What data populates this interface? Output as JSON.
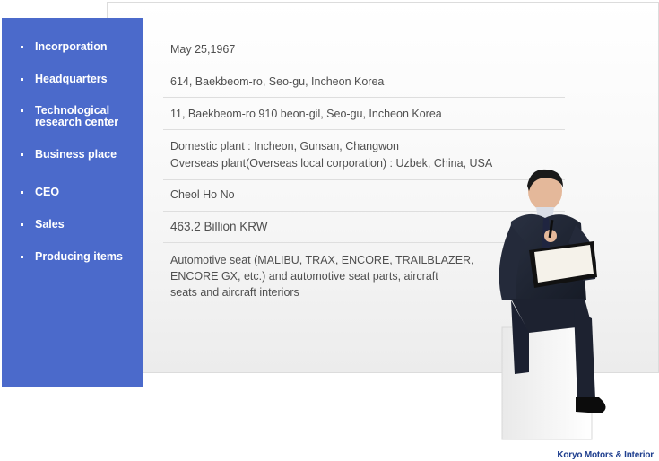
{
  "sidebar": {
    "items": [
      {
        "label": "Incorporation"
      },
      {
        "label": "Headquarters"
      },
      {
        "label": "Technological research center"
      },
      {
        "label": "Business place"
      },
      {
        "label": "CEO"
      },
      {
        "label": "Sales"
      },
      {
        "label": "Producing items"
      }
    ]
  },
  "details": {
    "incorporation": "May 25,1967",
    "headquarters": "614, Baekbeom-ro, Seo-gu, Incheon  Korea",
    "research_center": "11, Baekbeom-ro 910 beon-gil, Seo-gu, Incheon  Korea",
    "business_place_line1": "Domestic plant :  Incheon, Gunsan, Changwon",
    "business_place_line2": "Overseas plant(Overseas local corporation) :  Uzbek, China, USA",
    "ceo": "Cheol Ho No",
    "sales": "463.2 Billion KRW",
    "producing_line1": "Automotive seat (MALIBU, TRAX, ENCORE, TRAILBLAZER,",
    "producing_line2": "ENCORE GX, etc.) and automotive seat parts, aircraft",
    "producing_line3": "seats and aircraft interiors"
  },
  "brand": {
    "label": "Koryo Motors & Interior"
  },
  "colors": {
    "sidebar": "#4b6acb",
    "text": "#4f4f4f",
    "brand": "#1f3f8f"
  }
}
